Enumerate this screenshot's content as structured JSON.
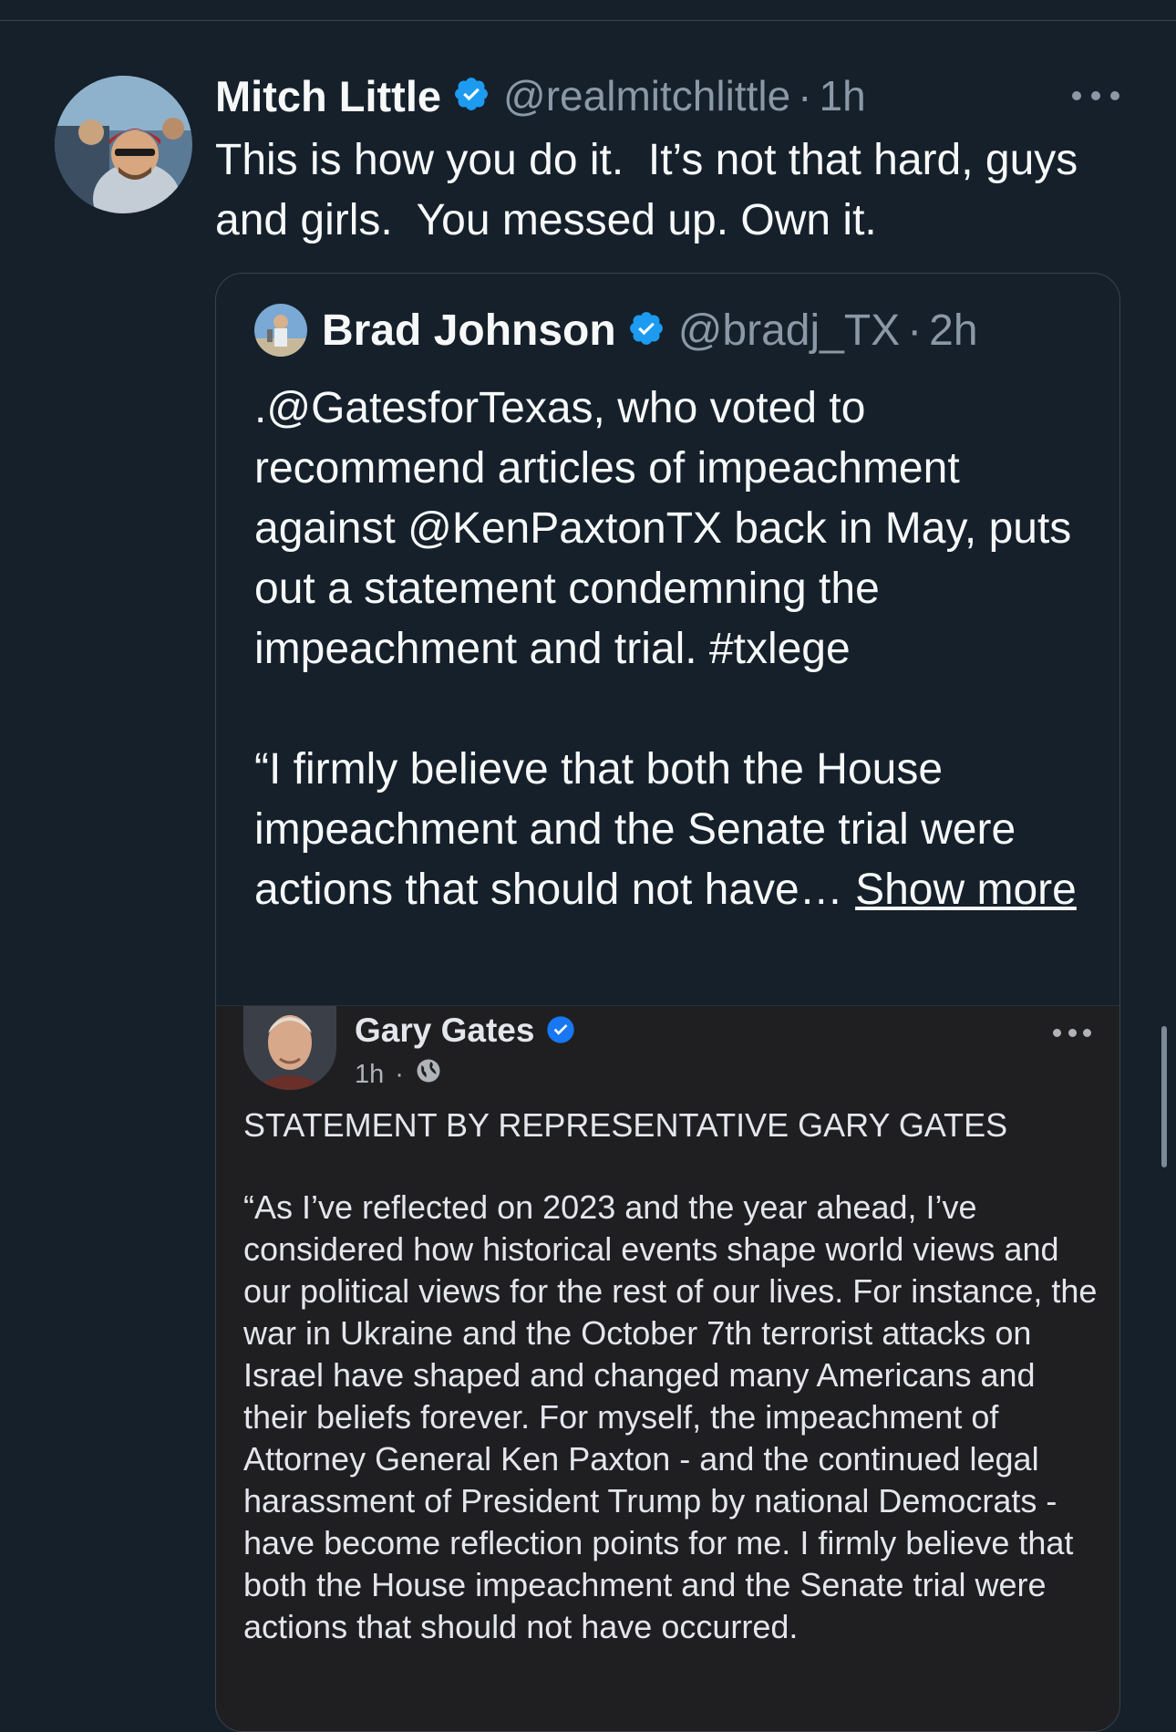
{
  "colors": {
    "background": "#15202b",
    "verified_blue": "#1d9bf0",
    "secondary_text": "#8b98a5"
  },
  "tweet": {
    "author_name": "Mitch Little",
    "author_handle": "@realmitchlittle",
    "separator": "·",
    "time": "1h",
    "text": "This is how you do it.  It’s not that hard, guys and girls.  You messed up. Own it.",
    "avatar_icon": "profile-photo",
    "more_icon": "more-options-icon"
  },
  "quote": {
    "author_name": "Brad Johnson",
    "author_handle": "@bradj_TX",
    "separator": "·",
    "time": "2h",
    "paragraph1": ".@GatesforTexas, who voted to recommend articles of impeachment against @KenPaxtonTX back in May, puts out a statement condemning the impeachment and trial. #txlege",
    "paragraph2": "“I firmly believe that both the House impeachment and the Senate trial were actions that should not have…",
    "show_more": "Show more"
  },
  "facebook_post": {
    "author_name": "Gary Gates",
    "time": "1h",
    "meta_separator": "·",
    "heading": "STATEMENT BY REPRESENTATIVE GARY GATES",
    "body": "“As I’ve reflected on 2023 and the year ahead, I’ve considered how historical events shape world views and our political views for the rest of our lives. For instance, the war in Ukraine and the October 7th terrorist attacks on Israel have shaped and changed many Americans and their beliefs forever. For myself, the impeachment of Attorney General Ken Paxton - and the continued legal harassment of President Trump by national Democrats - have become reflection points for me.  I firmly believe that both the House impeachment and the Senate trial were actions that should not have occurred."
  }
}
